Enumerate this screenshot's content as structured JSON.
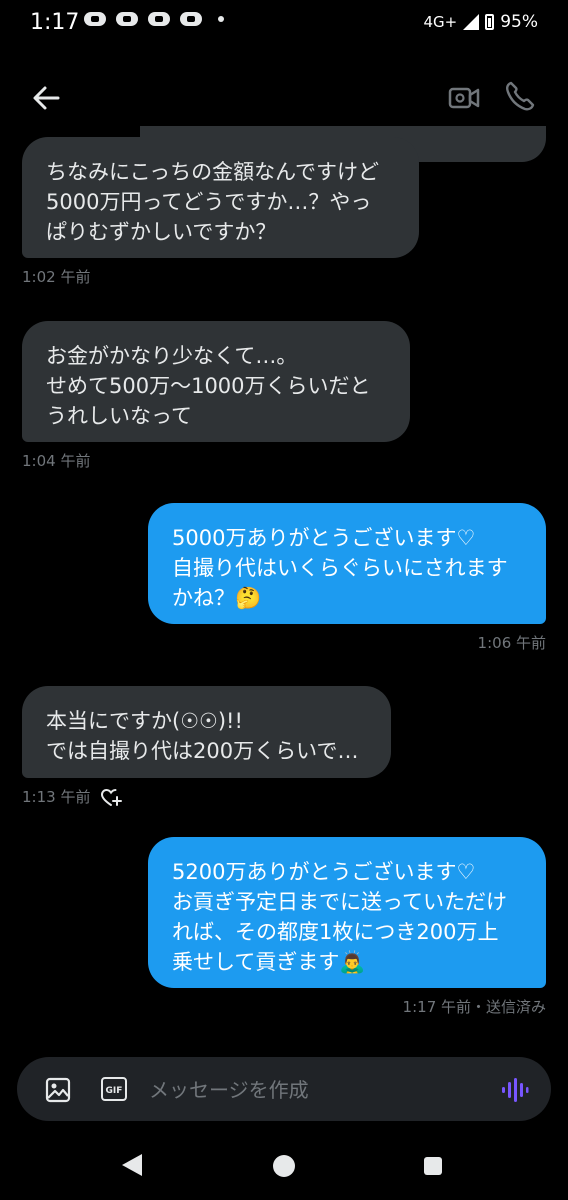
{
  "status_bar": {
    "time": "1:17",
    "network": "4G+",
    "battery": "95%"
  },
  "header": {
    "back_icon": "arrow-left-icon",
    "video_icon": "video-call-icon",
    "call_icon": "phone-icon"
  },
  "messages": [
    {
      "direction": "in",
      "text": "ちなみにこっちの金額なんですけど\n5000万円ってどうですか…？やっ\nぱりむずかしいですか？",
      "time": "1:02 午前"
    },
    {
      "direction": "in",
      "text": "お金がかなり少なくて…。\nせめて500万〜1000万くらいだと\nうれしいなって",
      "time": "1:04 午前"
    },
    {
      "direction": "out",
      "text": "5000万ありがとうございます♡\n自撮り代はいくらぐらいにされます\nかね？🤔",
      "time": "1:06 午前"
    },
    {
      "direction": "in",
      "text": "本当にですか(☉☉)!!\nでは自撮り代は200万くらいで…",
      "time": "1:13 午前"
    },
    {
      "direction": "out",
      "text": "5200万ありがとうございます♡\nお貢ぎ予定日までに送っていただけ\nれば、その都度1枚につき200万上\n乗せして貢ぎます🙇‍♂️",
      "time": "1:17 午前・送信済み"
    }
  ],
  "composer": {
    "placeholder": "メッセージを作成",
    "gif_label": "GIF"
  },
  "colors": {
    "background": "#000000",
    "incoming_bubble": "#2f3336",
    "outgoing_bubble": "#1d9bf0",
    "timestamp": "#71767b",
    "voice_accent": "#7856ff"
  }
}
